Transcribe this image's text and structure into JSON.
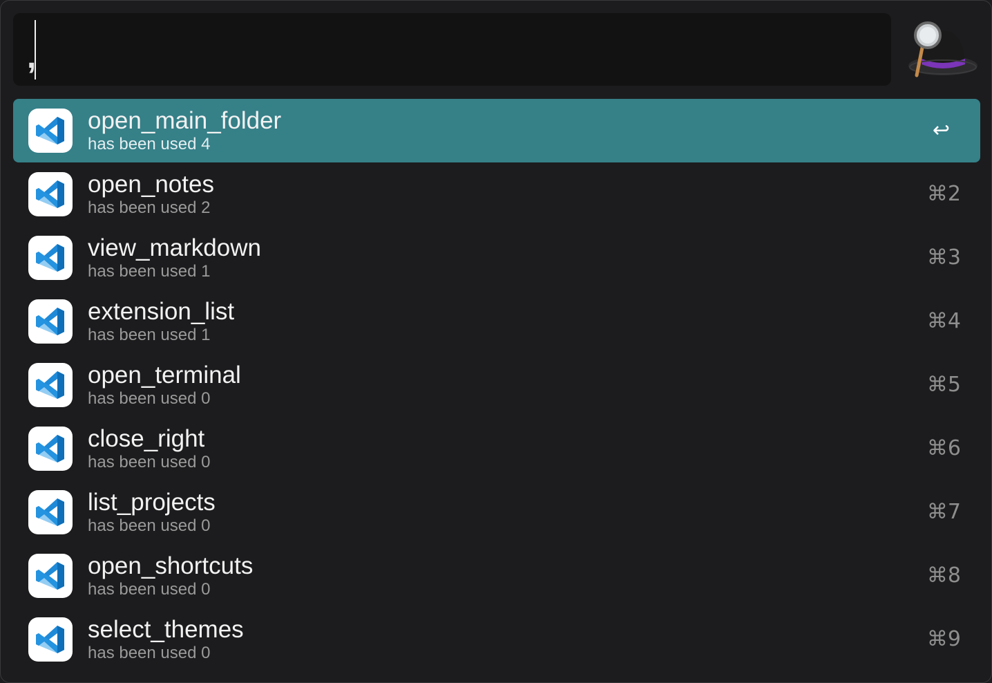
{
  "search": {
    "query": ","
  },
  "results": [
    {
      "title": "open_main_folder",
      "subtitle": "has been used 4",
      "shortcut": "↩",
      "selected": true
    },
    {
      "title": "open_notes",
      "subtitle": "has been used 2",
      "shortcut": "⌘2"
    },
    {
      "title": "view_markdown",
      "subtitle": "has been used 1",
      "shortcut": "⌘3"
    },
    {
      "title": "extension_list",
      "subtitle": "has been used 1",
      "shortcut": "⌘4"
    },
    {
      "title": "open_terminal",
      "subtitle": "has been used 0",
      "shortcut": "⌘5"
    },
    {
      "title": "close_right",
      "subtitle": "has been used 0",
      "shortcut": "⌘6"
    },
    {
      "title": "list_projects",
      "subtitle": "has been used 0",
      "shortcut": "⌘7"
    },
    {
      "title": "open_shortcuts",
      "subtitle": "has been used 0",
      "shortcut": "⌘8"
    },
    {
      "title": "select_themes",
      "subtitle": "has been used 0",
      "shortcut": "⌘9"
    }
  ],
  "icons": {
    "app": "vscode-icon",
    "logo": "alfred-hat-icon",
    "enter": "return-icon"
  },
  "colors": {
    "selected_row": "#368088",
    "vscode_blue": "#1f8ad8"
  }
}
